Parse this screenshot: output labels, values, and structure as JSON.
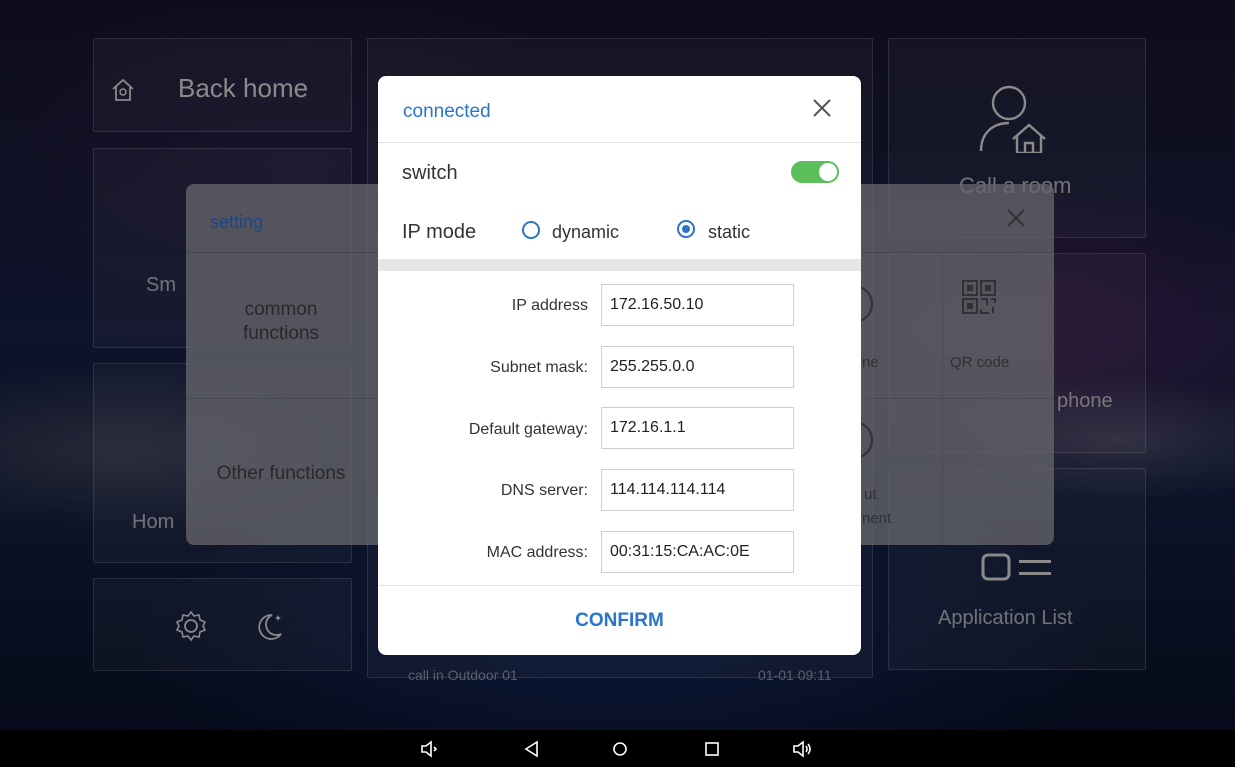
{
  "background": {
    "back_home_label": "Back home",
    "call_room_label": "Call a room",
    "smart_partial": "Sm",
    "home_partial": "Hom",
    "phone_partial": "phone",
    "app_list_label": "Application List",
    "call_log_text": "call in Outdoor 01",
    "call_log_time": "01-01 09:11"
  },
  "setting": {
    "title": "setting",
    "left_items": [
      "common functions",
      "Other functions"
    ],
    "grid_labels": {
      "partial_ne": "ne",
      "qr_code": "QR code",
      "partial_ut": "ut",
      "partial_nent": "nent"
    }
  },
  "dialog": {
    "title": "connected",
    "switch_label": "switch",
    "switch_on": true,
    "ip_mode_label": "IP mode",
    "ip_mode_options": [
      "dynamic",
      "static"
    ],
    "ip_mode_selected": "static",
    "fields": [
      {
        "label": "IP address",
        "value": "172.16.50.10"
      },
      {
        "label": "Subnet mask:",
        "value": "255.255.0.0"
      },
      {
        "label": "Default gateway:",
        "value": "172.16.1.1"
      },
      {
        "label": "DNS server:",
        "value": "114.114.114.114"
      },
      {
        "label": "MAC address:",
        "value": "00:31:15:CA:AC:0E"
      }
    ],
    "confirm_label": "CONFIRM"
  },
  "colors": {
    "accent": "#2a74c9",
    "toggle_on": "#5cbf5c"
  },
  "navbar": {
    "icons": [
      "volume-down-icon",
      "back-icon",
      "home-icon",
      "recents-icon",
      "volume-up-icon"
    ]
  }
}
